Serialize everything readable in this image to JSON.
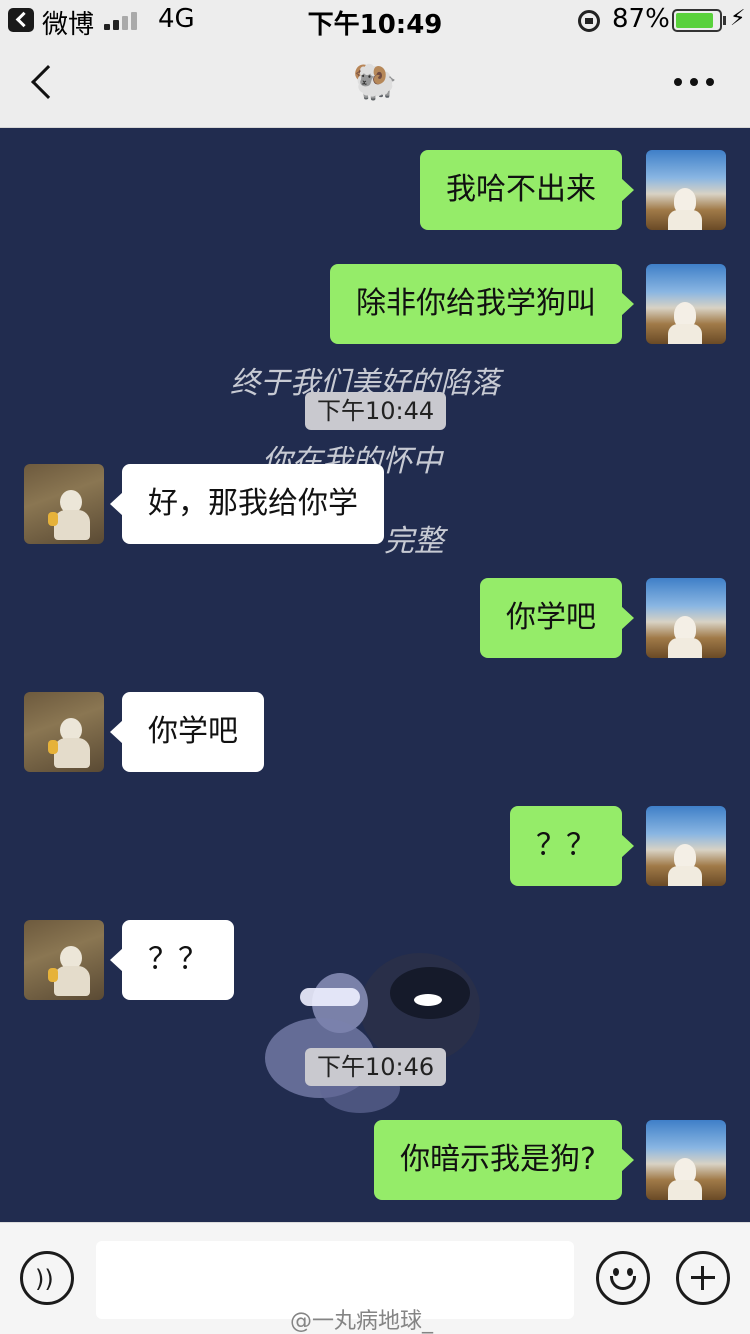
{
  "status_bar": {
    "app_name": "微博",
    "network": "4G",
    "time": "下午10:49",
    "battery_percent": "87%",
    "battery_level": 0.87
  },
  "nav": {
    "title": "🐏",
    "back_icon": "chevron-left-icon",
    "more_icon": "more-dots-icon"
  },
  "background_text": [
    "终于我们美好的陷落",
    "你在我的怀中",
    "完整"
  ],
  "messages": [
    {
      "type": "message",
      "side": "self",
      "text": "我哈不出来"
    },
    {
      "type": "message",
      "side": "self",
      "text": "除非你给我学狗叫"
    },
    {
      "type": "timestamp",
      "text": "下午10:44"
    },
    {
      "type": "message",
      "side": "other",
      "text": "好，那我给你学"
    },
    {
      "type": "message",
      "side": "self",
      "text": "你学吧"
    },
    {
      "type": "message",
      "side": "other",
      "text": "你学吧"
    },
    {
      "type": "message",
      "side": "self",
      "text": "？？"
    },
    {
      "type": "message",
      "side": "other",
      "text": "？？"
    },
    {
      "type": "timestamp",
      "text": "下午10:46"
    },
    {
      "type": "message",
      "side": "self",
      "text": "你暗示我是狗?"
    }
  ],
  "input_bar": {
    "voice_icon": "voice-icon",
    "input_value": "",
    "emoji_icon": "emoji-icon",
    "plus_icon": "plus-icon"
  },
  "watermark": "@一丸病地球_",
  "colors": {
    "self_bubble": "#95ec69",
    "other_bubble": "#ffffff",
    "chat_background": "#212c4f"
  }
}
